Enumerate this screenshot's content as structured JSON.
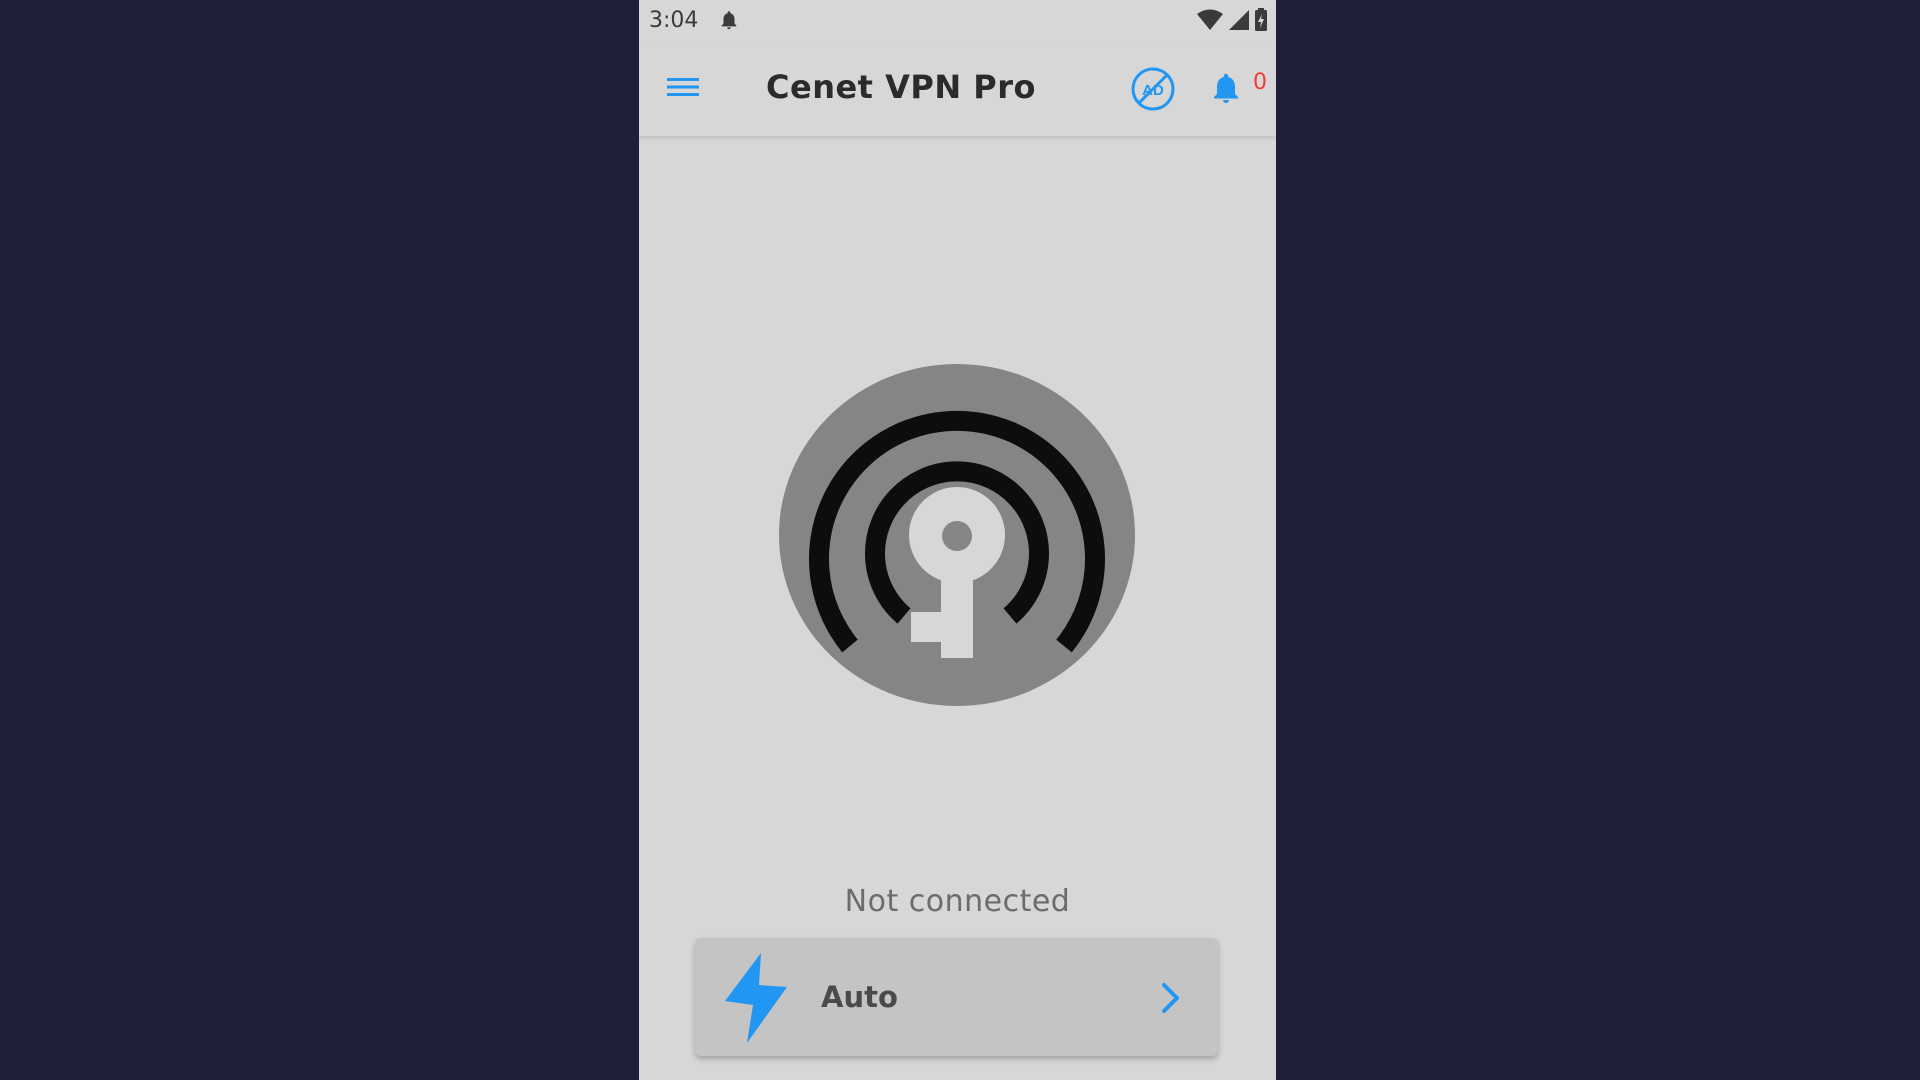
{
  "status_bar": {
    "time": "3:04",
    "notification_icon": "bell-icon",
    "wifi_icon": "wifi-icon",
    "signal_icon": "cell-signal-icon",
    "battery_icon": "battery-charging-icon"
  },
  "app_bar": {
    "menu_icon": "hamburger-menu-icon",
    "title": "Cenet VPN Pro",
    "no_ads_icon": "no-ads-icon",
    "no_ads_text": "AD",
    "notification_icon": "bell-icon",
    "notification_count": "0"
  },
  "main": {
    "connect_icon": "vpn-key-signal-icon",
    "connection_status": "Not connected"
  },
  "server_selector": {
    "icon": "lightning-bolt-icon",
    "label": "Auto",
    "chevron_icon": "chevron-right-icon"
  },
  "colors": {
    "accent": "#2196f3",
    "background": "#d7d7d7",
    "outer_background": "#201f3a",
    "badge": "#f03a3a",
    "connect_circle": "#858585"
  }
}
